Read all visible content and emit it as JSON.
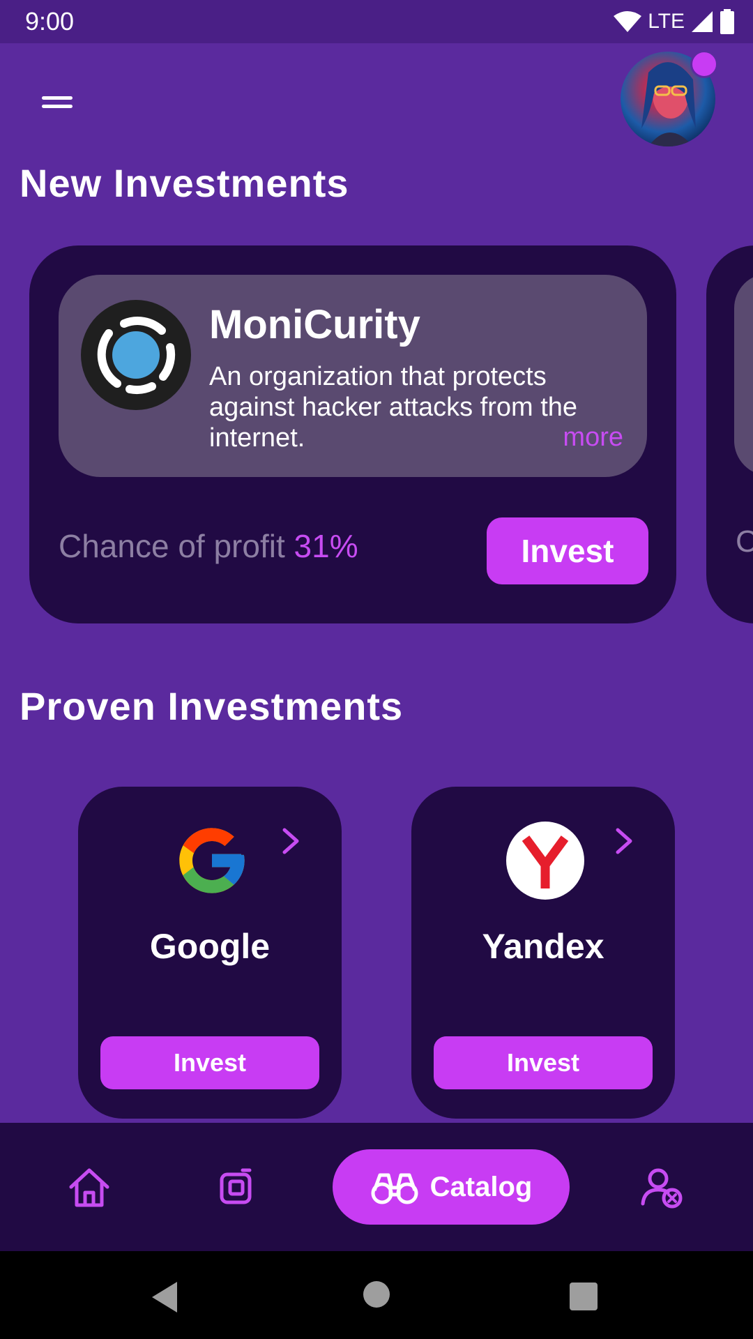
{
  "status_bar": {
    "time": "9:00",
    "network": "LTE"
  },
  "new_investments": {
    "title": "New Investments",
    "featured": {
      "name": "MoniCurity",
      "description": "An organization that protects against hacker attacks from the internet.",
      "more_label": "more",
      "profit_label": "Chance of profit",
      "profit_value": "31%",
      "invest_label": "Invest"
    },
    "next_card_peek_text": "C"
  },
  "proven_investments": {
    "title": "Proven Investments",
    "items": [
      {
        "name": "Google",
        "invest_label": "Invest",
        "logo": "google-logo"
      },
      {
        "name": "Yandex",
        "invest_label": "Invest",
        "logo": "yandex-logo"
      }
    ]
  },
  "bottom_nav": {
    "items": [
      {
        "icon": "home-icon"
      },
      {
        "icon": "portfolio-icon"
      },
      {
        "icon": "binoculars-icon",
        "label": "Catalog",
        "active": true
      },
      {
        "icon": "user-remove-icon"
      }
    ]
  },
  "colors": {
    "background": "#5b2a9e",
    "card": "#210a44",
    "accent": "#c83cf3",
    "muted": "#8d7fa3"
  }
}
